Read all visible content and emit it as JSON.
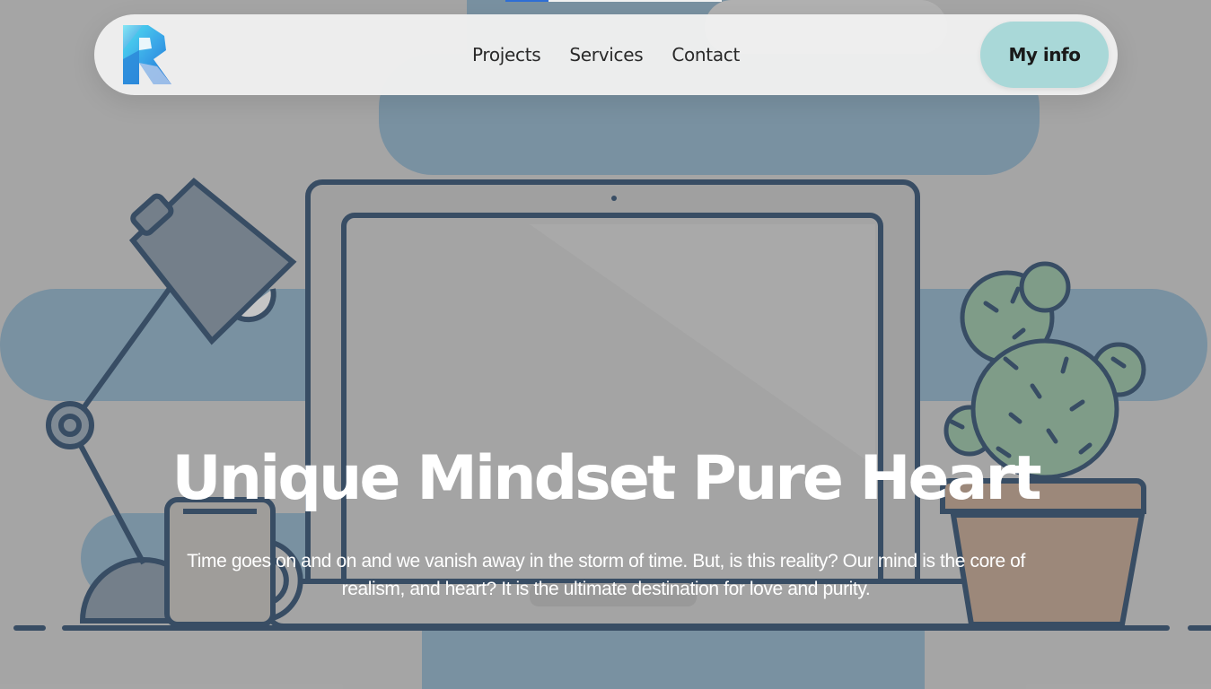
{
  "nav": {
    "links": [
      "Projects",
      "Services",
      "Contact"
    ],
    "cta_label": "My info"
  },
  "hero": {
    "title": "Unique Mindset Pure Heart",
    "text": "Time goes on and on and we vanish away in the storm of time. But, is this reality? Our mind is the core of realism, and heart? It is the ultimate destination for love and purity."
  },
  "icons": {
    "logo": "letter-r-logo-icon"
  },
  "colors": {
    "page_background": "#a9a9a9",
    "navbar_background": "#f0f0f0",
    "cta_background": "#a9d8d8",
    "illustration_blue": "#7390a4",
    "outline_navy": "#243d5a",
    "cactus_green": "#7a9e85",
    "pot_brown": "#9e8674",
    "hero_text": "#ffffff"
  }
}
